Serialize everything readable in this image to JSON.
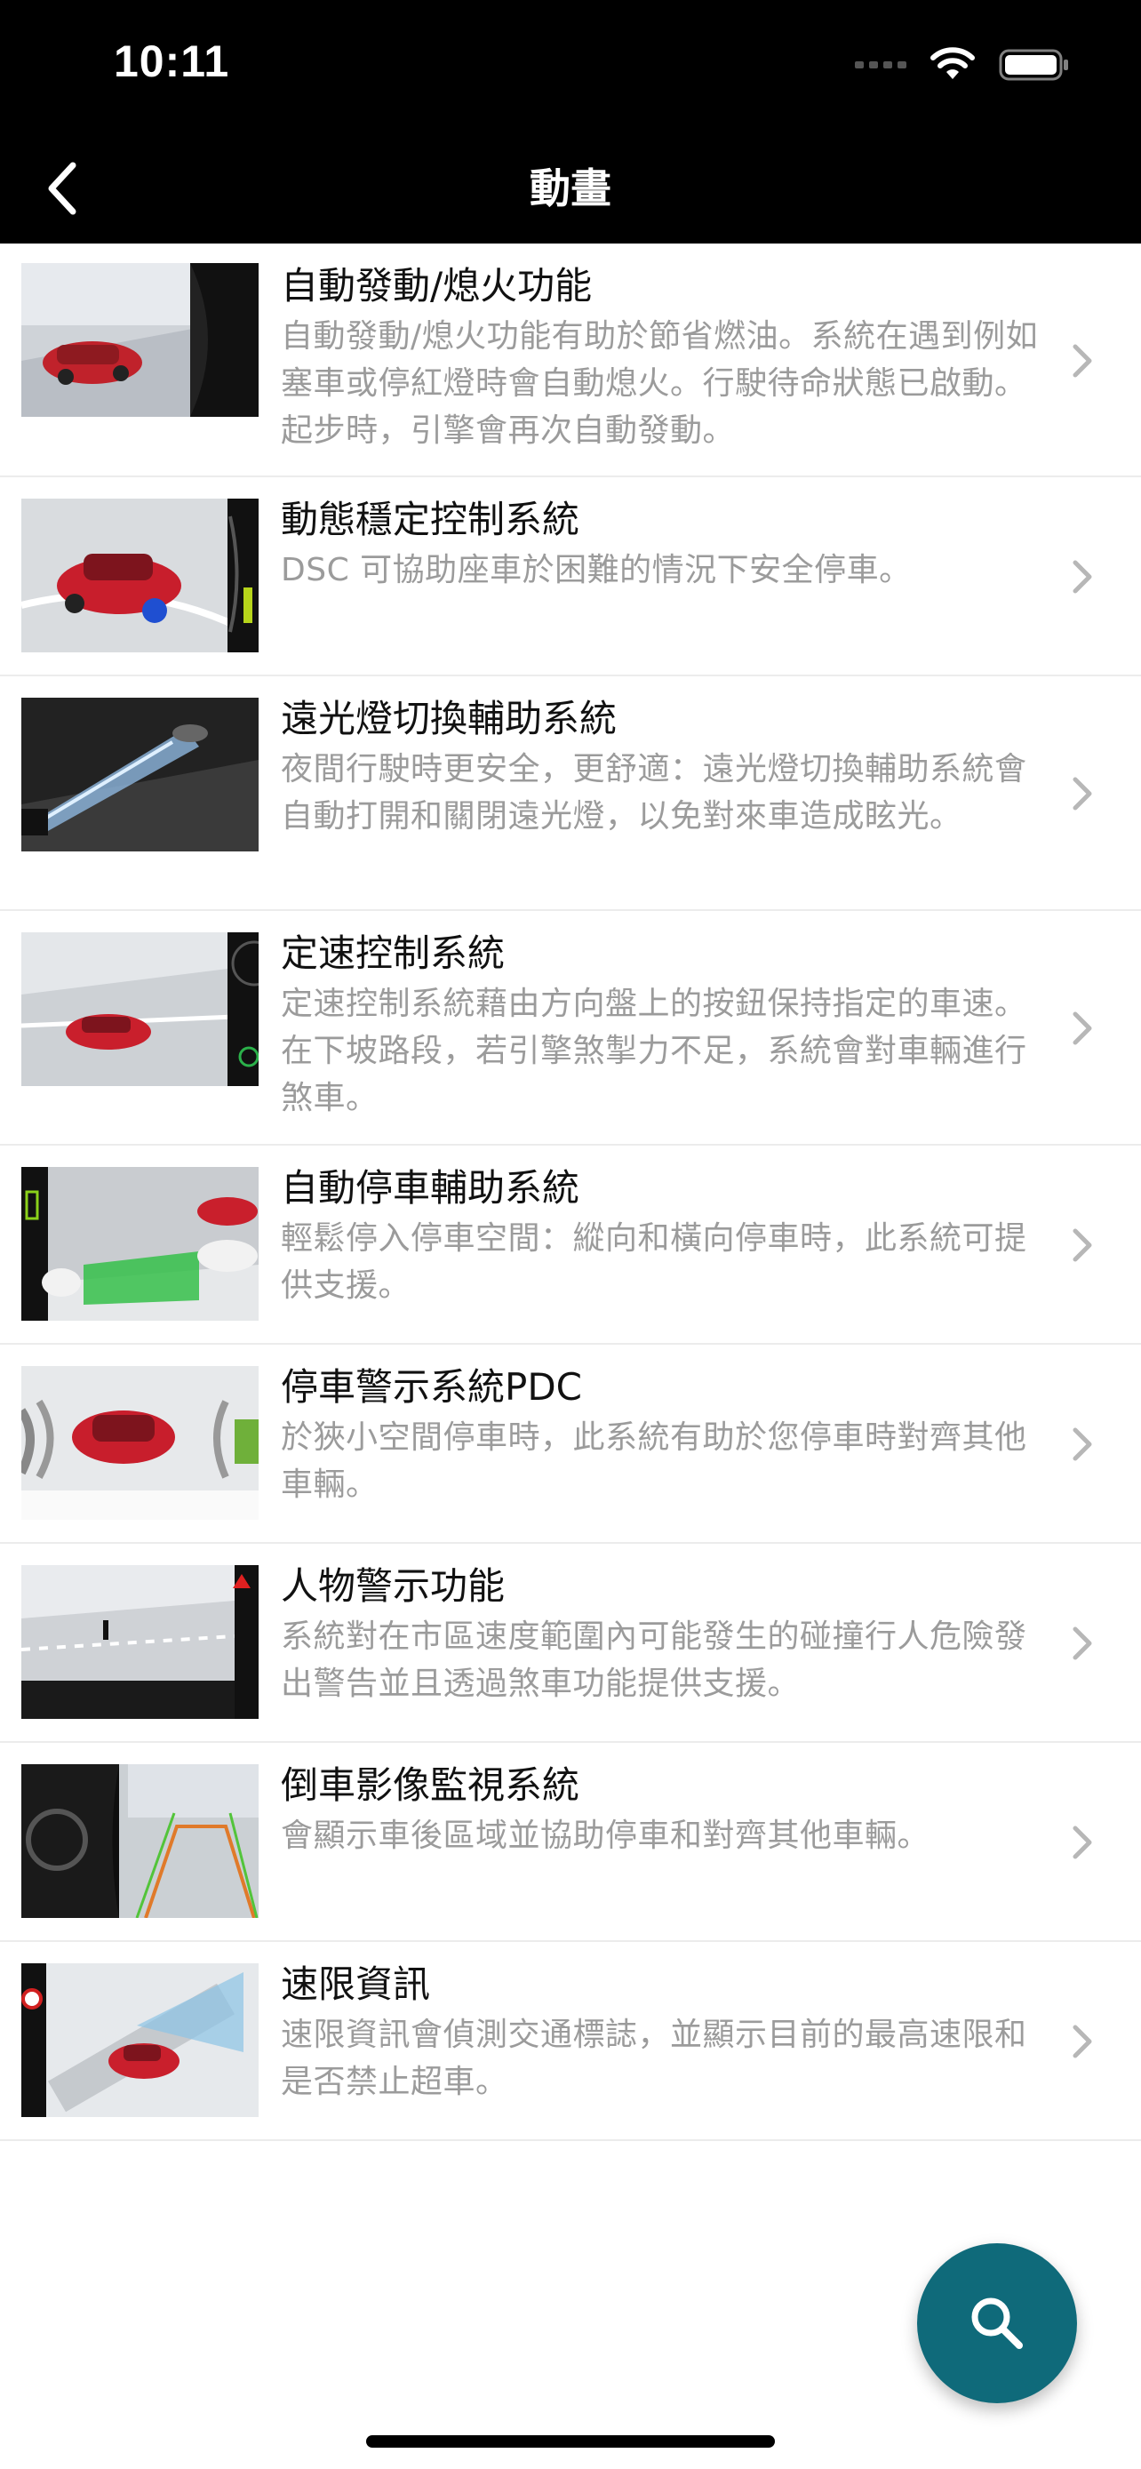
{
  "status_bar": {
    "time": "10:11"
  },
  "nav": {
    "title": "動畫"
  },
  "items": [
    {
      "title": "自動發動/熄火功能",
      "description": "自動發動/熄火功能有助於節省燃油。系統在遇到例如塞車或停紅燈時會自動熄火。行駛待命狀態已啟動。起步時，引擎會再次自動發動。",
      "thumbnail": "start-stop-animation"
    },
    {
      "title": "動態穩定控制系統",
      "description": "DSC 可協助座車於困難的情況下安全停車。",
      "thumbnail": "dsc-animation"
    },
    {
      "title": "遠光燈切換輔助系統",
      "description": "夜間行駛時更安全，更舒適：遠光燈切換輔助系統會自動打開和關閉遠光燈，以免對來車造成眩光。",
      "thumbnail": "high-beam-assistant-animation"
    },
    {
      "title": "定速控制系統",
      "description": "定速控制系統藉由方向盤上的按鈕保持指定的車速。在下坡路段，若引擎煞掣力不足，系統會對車輛進行煞車。",
      "thumbnail": "cruise-control-animation"
    },
    {
      "title": "自動停車輔助系統",
      "description": "輕鬆停入停車空間：縱向和橫向停車時，此系統可提供支援。",
      "thumbnail": "parking-assistant-animation"
    },
    {
      "title": "停車警示系統PDC",
      "description": "於狹小空間停車時，此系統有助於您停車時對齊其他車輛。",
      "thumbnail": "pdc-animation"
    },
    {
      "title": "人物警示功能",
      "description": "系統對在市區速度範圍內可能發生的碰撞行人危險發出警告並且透過煞車功能提供支援。",
      "thumbnail": "pedestrian-warning-animation"
    },
    {
      "title": "倒車影像監視系統",
      "description": "會顯示車後區域並協助停車和對齊其他車輛。",
      "thumbnail": "rear-view-camera-animation"
    },
    {
      "title": "速限資訊",
      "description": "速限資訊會偵測交通標誌，並顯示目前的最高速限和是否禁止超車。",
      "thumbnail": "speed-limit-info-animation"
    }
  ],
  "search_button": {
    "icon": "search-icon",
    "color": "#0f6a7a"
  }
}
